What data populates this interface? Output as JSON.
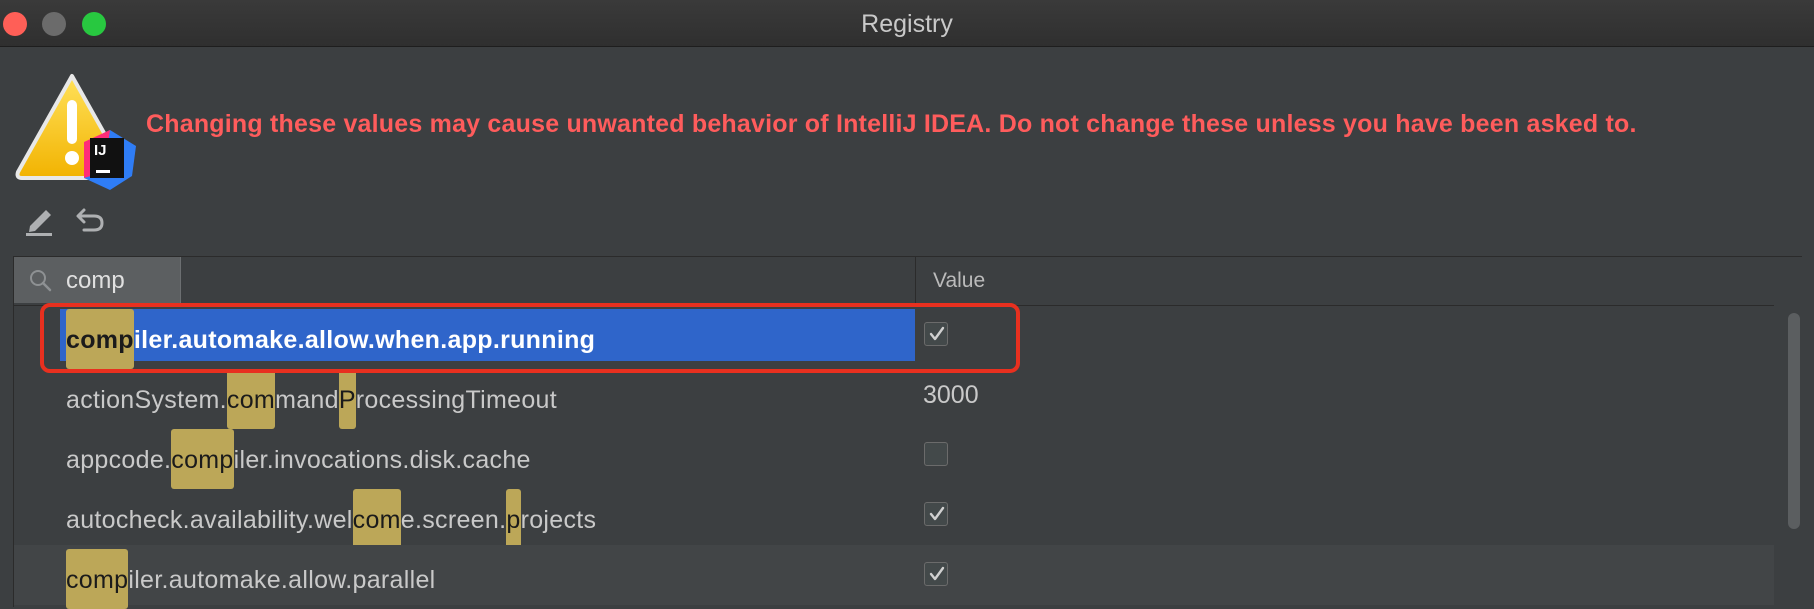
{
  "window": {
    "title": "Registry"
  },
  "warning": {
    "text": "Changing these values may cause unwanted behavior of IntelliJ IDEA. Do not change these unless you have been asked to.",
    "badge": "IJ",
    "text_color": "#ff5c5c"
  },
  "toolbar": {
    "edit_icon": "pencil-icon",
    "revert_icon": "undo-icon"
  },
  "search": {
    "query": "comp",
    "placeholder": ""
  },
  "table": {
    "columns": [
      "",
      "Value"
    ],
    "rows": [
      {
        "parts": [
          {
            "t": "comp",
            "h": true
          },
          {
            "t": "iler.automake.allow.when.app.running",
            "h": false
          }
        ],
        "value_type": "checkbox",
        "checked": true,
        "selected": true
      },
      {
        "parts": [
          {
            "t": "actionSystem.",
            "h": false
          },
          {
            "t": "com",
            "h": true
          },
          {
            "t": "mand",
            "h": false
          },
          {
            "t": "P",
            "h": true
          },
          {
            "t": "rocessingTimeout",
            "h": false
          }
        ],
        "value_type": "text",
        "value": "3000",
        "selected": false
      },
      {
        "parts": [
          {
            "t": "appcode.",
            "h": false
          },
          {
            "t": "comp",
            "h": true
          },
          {
            "t": "iler.invocations.disk.cache",
            "h": false
          }
        ],
        "value_type": "checkbox",
        "checked": false,
        "selected": false
      },
      {
        "parts": [
          {
            "t": "autocheck.availability.wel",
            "h": false
          },
          {
            "t": "com",
            "h": true
          },
          {
            "t": "e.screen.",
            "h": false
          },
          {
            "t": "p",
            "h": true
          },
          {
            "t": "rojects",
            "h": false
          }
        ],
        "value_type": "checkbox",
        "checked": true,
        "selected": false
      },
      {
        "parts": [
          {
            "t": "comp",
            "h": true
          },
          {
            "t": "iler.automake.allow.parallel",
            "h": false
          }
        ],
        "value_type": "checkbox",
        "checked": true,
        "selected": false
      }
    ]
  },
  "colors": {
    "selection": "#2f65ca",
    "highlight": "#bca758",
    "annotation": "#e8301f"
  }
}
